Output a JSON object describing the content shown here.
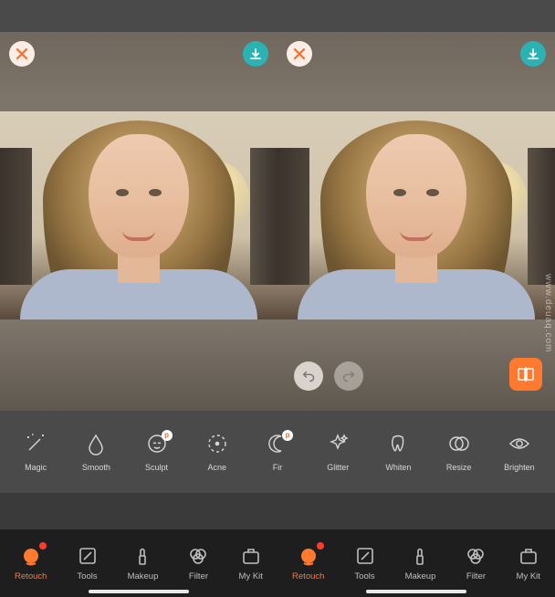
{
  "actions": {
    "close": "✕",
    "save": "↓"
  },
  "history": {
    "undo": "↶",
    "redo": "↷",
    "compare": "⧉"
  },
  "tools": [
    {
      "key": "magic",
      "label": "Magic",
      "icon": "magic-wand-icon"
    },
    {
      "key": "smooth",
      "label": "Smooth",
      "icon": "droplet-icon"
    },
    {
      "key": "sculpt",
      "label": "Sculpt",
      "icon": "face-sculpt-icon",
      "badge": "p"
    },
    {
      "key": "acne",
      "label": "Acne",
      "icon": "target-icon"
    },
    {
      "key": "firm",
      "label": "Fir",
      "icon": "crescent-icon",
      "badge": "p"
    },
    {
      "key": "glitter",
      "label": "Glitter",
      "icon": "sparkle-icon"
    },
    {
      "key": "whiten",
      "label": "Whiten",
      "icon": "tooth-icon"
    },
    {
      "key": "resize",
      "label": "Resize",
      "icon": "resize-icon"
    },
    {
      "key": "brighten",
      "label": "Brighten",
      "icon": "eye-icon"
    }
  ],
  "tabs": [
    {
      "key": "retouch",
      "label": "Retouch",
      "icon": "retouch-icon",
      "notif": true,
      "active": true
    },
    {
      "key": "tools",
      "label": "Tools",
      "icon": "edit-icon"
    },
    {
      "key": "makeup",
      "label": "Makeup",
      "icon": "lipstick-icon"
    },
    {
      "key": "filter",
      "label": "Filter",
      "icon": "filter-rings-icon"
    },
    {
      "key": "mykit",
      "label": "My Kit",
      "icon": "kit-icon"
    }
  ],
  "watermark": "www.deuaq.com",
  "colors": {
    "accent": "#ff7a2e",
    "teal": "#2bb3b3"
  }
}
